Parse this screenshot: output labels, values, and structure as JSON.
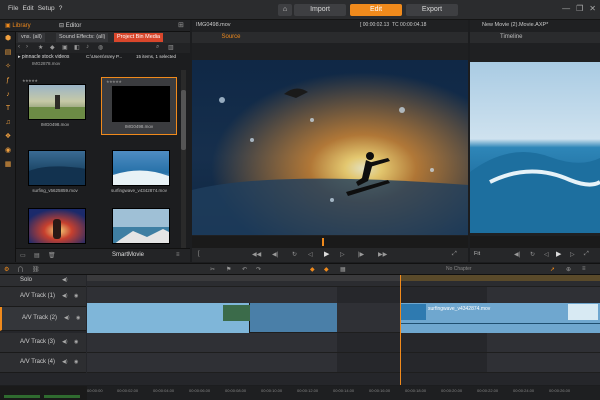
{
  "menu": {
    "file": "File",
    "edit": "Edit",
    "setup": "Setup",
    "help": "?"
  },
  "nav": {
    "import": "Import",
    "edit": "Edit",
    "export": "Export",
    "active": "edit"
  },
  "window": {
    "minimize": "—",
    "restore": "❐",
    "close": "✕"
  },
  "library": {
    "tabs": {
      "library": "Library",
      "editor": "Editor"
    },
    "headers": [
      "vns. (all)",
      "Sound Effects: (all)",
      "Project Bin Media"
    ],
    "collection": "pinnacle stock videos",
    "path": "C:\\Users\\rsrey P...",
    "count": "15 items, 1 selected",
    "path_file": "IMG2878.mov",
    "thumbs": [
      {
        "caption": "IMG0498.mov"
      },
      {
        "caption": "IMG0498.mov"
      },
      {
        "caption": "surfing_v5625859.mov"
      },
      {
        "caption": "surfingwave_v4342874.mov"
      },
      {
        "caption": ""
      },
      {
        "caption": ""
      }
    ],
    "bottom_label": "SmartMovie"
  },
  "source": {
    "filename": "IMG0498.mov",
    "tab": "Source",
    "tc_in": "[ 00:00:02.13",
    "tc_out": "TC 00:00:04.18"
  },
  "timeline_panel": {
    "filename": "New Movie (2).Movie.AXP*",
    "tab": "Timeline"
  },
  "tracks": [
    {
      "name": "Solo"
    },
    {
      "name": "A/V Track (1)"
    },
    {
      "name": "A/V Track (2)"
    },
    {
      "name": "A/V Track (3)"
    },
    {
      "name": "A/V Track (4)"
    }
  ],
  "clip": {
    "name": "surfingwave_v4342874.mov"
  },
  "toolbar": {
    "no_chapter": "No Chapter",
    "fit": "Fit"
  },
  "ruler": [
    "00:00:00",
    "00:00:02.00",
    "00:00:04.00",
    "00:00:06.00",
    "00:00:08.00",
    "00:00:10.00",
    "00:00:12.00",
    "00:00:14.00",
    "00:00:16.00",
    "00:00:18.00",
    "00:00:20.00",
    "00:00:22.00",
    "00:00:24.00",
    "00:00:26.00"
  ],
  "colors": {
    "accent": "#f08a1c",
    "bin": "#d9462b"
  }
}
